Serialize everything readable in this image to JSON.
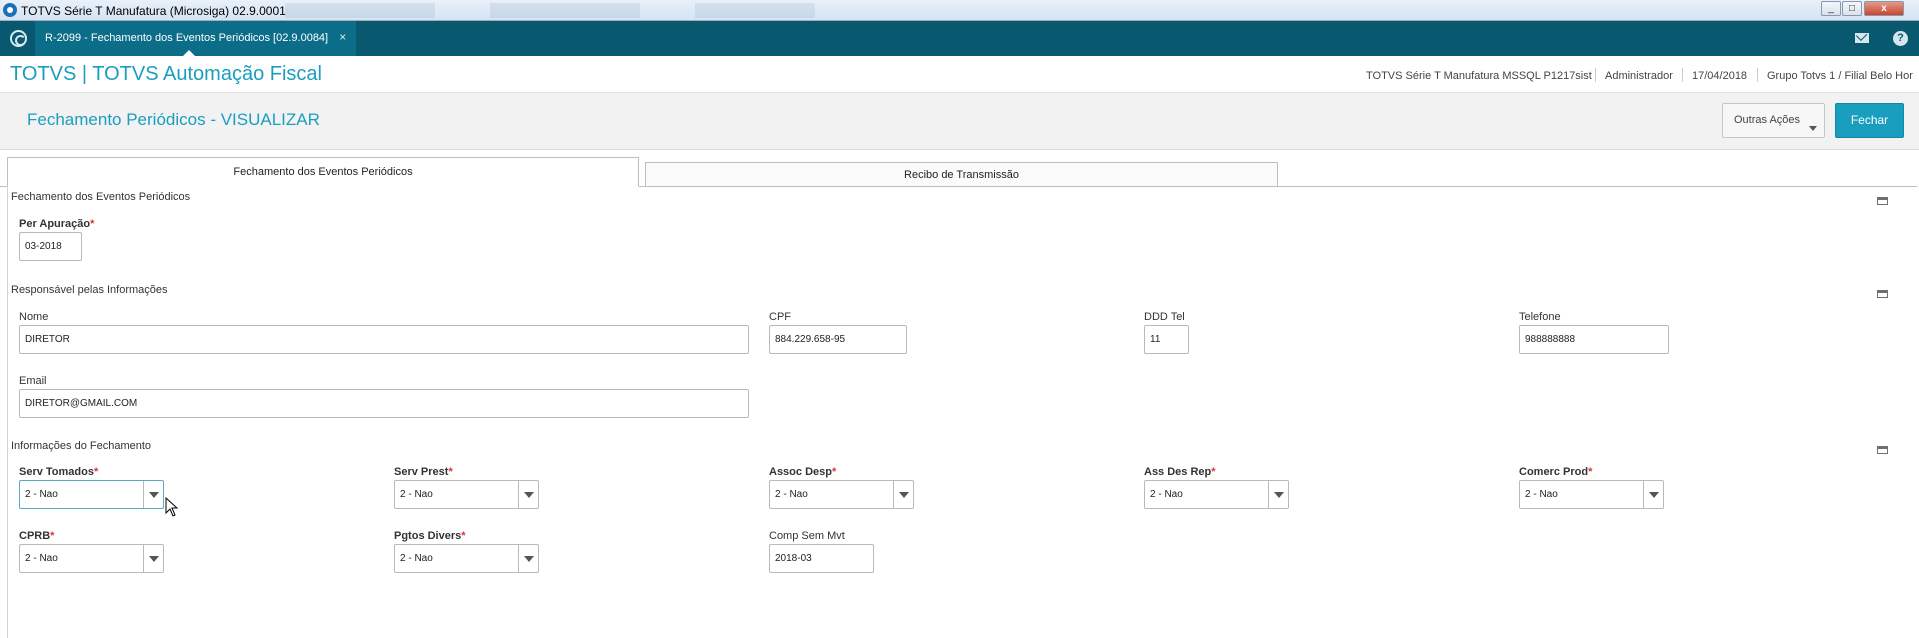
{
  "window": {
    "title": "TOTVS Série T Manufatura (Microsiga) 02.9.0001",
    "minimize": "_",
    "maximize": "□",
    "close": "x"
  },
  "tabbar": {
    "active_tab": "R-2099 - Fechamento dos Eventos Periódicos [02.9.0084]",
    "close_symbol": "×",
    "help_symbol": "?"
  },
  "header": {
    "brand": "TOTVS | TOTVS Automação Fiscal",
    "environment": "TOTVS Série T Manufatura MSSQL P1217sist",
    "user": "Administrador",
    "date": "17/04/2018",
    "branch": "Grupo Totvs 1 / Filial Belo Hor"
  },
  "toolbar": {
    "page_title": "Fechamento Periódicos - VISUALIZAR",
    "outras_acoes": "Outras Ações",
    "fechar": "Fechar"
  },
  "tabs": [
    {
      "label": "Fechamento dos Eventos Periódicos"
    },
    {
      "label": "Recibo de Transmissão"
    }
  ],
  "sections": {
    "fechamento": {
      "title": "Fechamento dos Eventos Periódicos",
      "per_apuracao_label": "Per Apuração",
      "per_apuracao_value": "03-2018"
    },
    "responsavel": {
      "title": "Responsável pelas Informações",
      "nome_label": "Nome",
      "nome_value": "DIRETOR",
      "cpf_label": "CPF",
      "cpf_value": "884.229.658-95",
      "ddd_label": "DDD Tel",
      "ddd_value": "11",
      "telefone_label": "Telefone",
      "telefone_value": "988888888",
      "email_label": "Email",
      "email_value": "DIRETOR@GMAIL.COM"
    },
    "informacoes": {
      "title": "Informações do Fechamento",
      "serv_tomados_label": "Serv Tomados",
      "serv_tomados_value": "2 - Nao",
      "serv_prest_label": "Serv Prest",
      "serv_prest_value": "2 - Nao",
      "assoc_desp_label": "Assoc Desp",
      "assoc_desp_value": "2 - Nao",
      "ass_des_rep_label": "Ass Des Rep",
      "ass_des_rep_value": "2 - Nao",
      "comerc_prod_label": "Comerc Prod",
      "comerc_prod_value": "2 - Nao",
      "cprb_label": "CPRB",
      "cprb_value": "2 - Nao",
      "pgtos_divers_label": "Pgtos Divers",
      "pgtos_divers_value": "2 - Nao",
      "comp_sem_mvt_label": "Comp Sem Mvt",
      "comp_sem_mvt_value": "2018-03"
    },
    "required_mark": "*"
  },
  "colors": {
    "teal_bar": "#08586f",
    "accent": "#1a9ec0",
    "required": "#e03030"
  }
}
